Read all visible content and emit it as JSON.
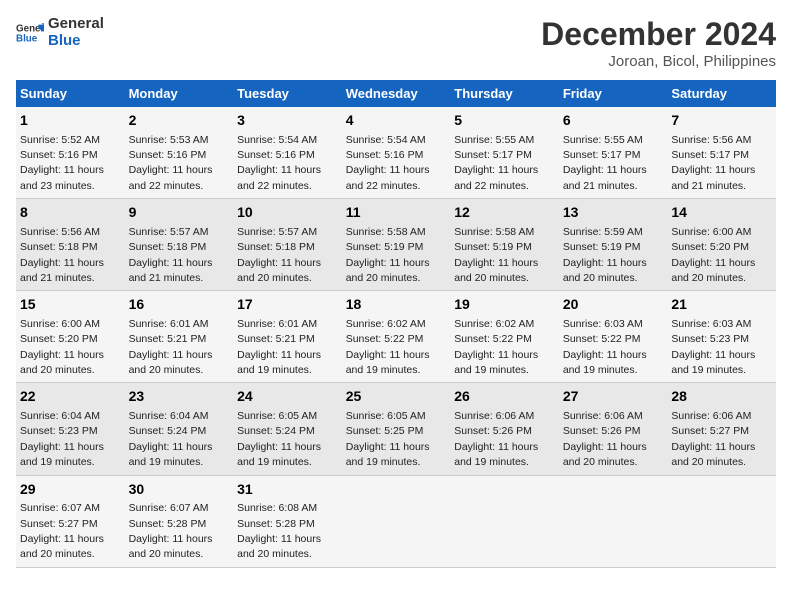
{
  "logo": {
    "line1": "General",
    "line2": "Blue"
  },
  "title": "December 2024",
  "subtitle": "Joroan, Bicol, Philippines",
  "days_of_week": [
    "Sunday",
    "Monday",
    "Tuesday",
    "Wednesday",
    "Thursday",
    "Friday",
    "Saturday"
  ],
  "weeks": [
    [
      {
        "day": "1",
        "info": "Sunrise: 5:52 AM\nSunset: 5:16 PM\nDaylight: 11 hours and 23 minutes."
      },
      {
        "day": "2",
        "info": "Sunrise: 5:53 AM\nSunset: 5:16 PM\nDaylight: 11 hours and 22 minutes."
      },
      {
        "day": "3",
        "info": "Sunrise: 5:54 AM\nSunset: 5:16 PM\nDaylight: 11 hours and 22 minutes."
      },
      {
        "day": "4",
        "info": "Sunrise: 5:54 AM\nSunset: 5:16 PM\nDaylight: 11 hours and 22 minutes."
      },
      {
        "day": "5",
        "info": "Sunrise: 5:55 AM\nSunset: 5:17 PM\nDaylight: 11 hours and 22 minutes."
      },
      {
        "day": "6",
        "info": "Sunrise: 5:55 AM\nSunset: 5:17 PM\nDaylight: 11 hours and 21 minutes."
      },
      {
        "day": "7",
        "info": "Sunrise: 5:56 AM\nSunset: 5:17 PM\nDaylight: 11 hours and 21 minutes."
      }
    ],
    [
      {
        "day": "8",
        "info": "Sunrise: 5:56 AM\nSunset: 5:18 PM\nDaylight: 11 hours and 21 minutes."
      },
      {
        "day": "9",
        "info": "Sunrise: 5:57 AM\nSunset: 5:18 PM\nDaylight: 11 hours and 21 minutes."
      },
      {
        "day": "10",
        "info": "Sunrise: 5:57 AM\nSunset: 5:18 PM\nDaylight: 11 hours and 20 minutes."
      },
      {
        "day": "11",
        "info": "Sunrise: 5:58 AM\nSunset: 5:19 PM\nDaylight: 11 hours and 20 minutes."
      },
      {
        "day": "12",
        "info": "Sunrise: 5:58 AM\nSunset: 5:19 PM\nDaylight: 11 hours and 20 minutes."
      },
      {
        "day": "13",
        "info": "Sunrise: 5:59 AM\nSunset: 5:19 PM\nDaylight: 11 hours and 20 minutes."
      },
      {
        "day": "14",
        "info": "Sunrise: 6:00 AM\nSunset: 5:20 PM\nDaylight: 11 hours and 20 minutes."
      }
    ],
    [
      {
        "day": "15",
        "info": "Sunrise: 6:00 AM\nSunset: 5:20 PM\nDaylight: 11 hours and 20 minutes."
      },
      {
        "day": "16",
        "info": "Sunrise: 6:01 AM\nSunset: 5:21 PM\nDaylight: 11 hours and 20 minutes."
      },
      {
        "day": "17",
        "info": "Sunrise: 6:01 AM\nSunset: 5:21 PM\nDaylight: 11 hours and 19 minutes."
      },
      {
        "day": "18",
        "info": "Sunrise: 6:02 AM\nSunset: 5:22 PM\nDaylight: 11 hours and 19 minutes."
      },
      {
        "day": "19",
        "info": "Sunrise: 6:02 AM\nSunset: 5:22 PM\nDaylight: 11 hours and 19 minutes."
      },
      {
        "day": "20",
        "info": "Sunrise: 6:03 AM\nSunset: 5:22 PM\nDaylight: 11 hours and 19 minutes."
      },
      {
        "day": "21",
        "info": "Sunrise: 6:03 AM\nSunset: 5:23 PM\nDaylight: 11 hours and 19 minutes."
      }
    ],
    [
      {
        "day": "22",
        "info": "Sunrise: 6:04 AM\nSunset: 5:23 PM\nDaylight: 11 hours and 19 minutes."
      },
      {
        "day": "23",
        "info": "Sunrise: 6:04 AM\nSunset: 5:24 PM\nDaylight: 11 hours and 19 minutes."
      },
      {
        "day": "24",
        "info": "Sunrise: 6:05 AM\nSunset: 5:24 PM\nDaylight: 11 hours and 19 minutes."
      },
      {
        "day": "25",
        "info": "Sunrise: 6:05 AM\nSunset: 5:25 PM\nDaylight: 11 hours and 19 minutes."
      },
      {
        "day": "26",
        "info": "Sunrise: 6:06 AM\nSunset: 5:26 PM\nDaylight: 11 hours and 19 minutes."
      },
      {
        "day": "27",
        "info": "Sunrise: 6:06 AM\nSunset: 5:26 PM\nDaylight: 11 hours and 20 minutes."
      },
      {
        "day": "28",
        "info": "Sunrise: 6:06 AM\nSunset: 5:27 PM\nDaylight: 11 hours and 20 minutes."
      }
    ],
    [
      {
        "day": "29",
        "info": "Sunrise: 6:07 AM\nSunset: 5:27 PM\nDaylight: 11 hours and 20 minutes."
      },
      {
        "day": "30",
        "info": "Sunrise: 6:07 AM\nSunset: 5:28 PM\nDaylight: 11 hours and 20 minutes."
      },
      {
        "day": "31",
        "info": "Sunrise: 6:08 AM\nSunset: 5:28 PM\nDaylight: 11 hours and 20 minutes."
      },
      {
        "day": "",
        "info": ""
      },
      {
        "day": "",
        "info": ""
      },
      {
        "day": "",
        "info": ""
      },
      {
        "day": "",
        "info": ""
      }
    ]
  ]
}
